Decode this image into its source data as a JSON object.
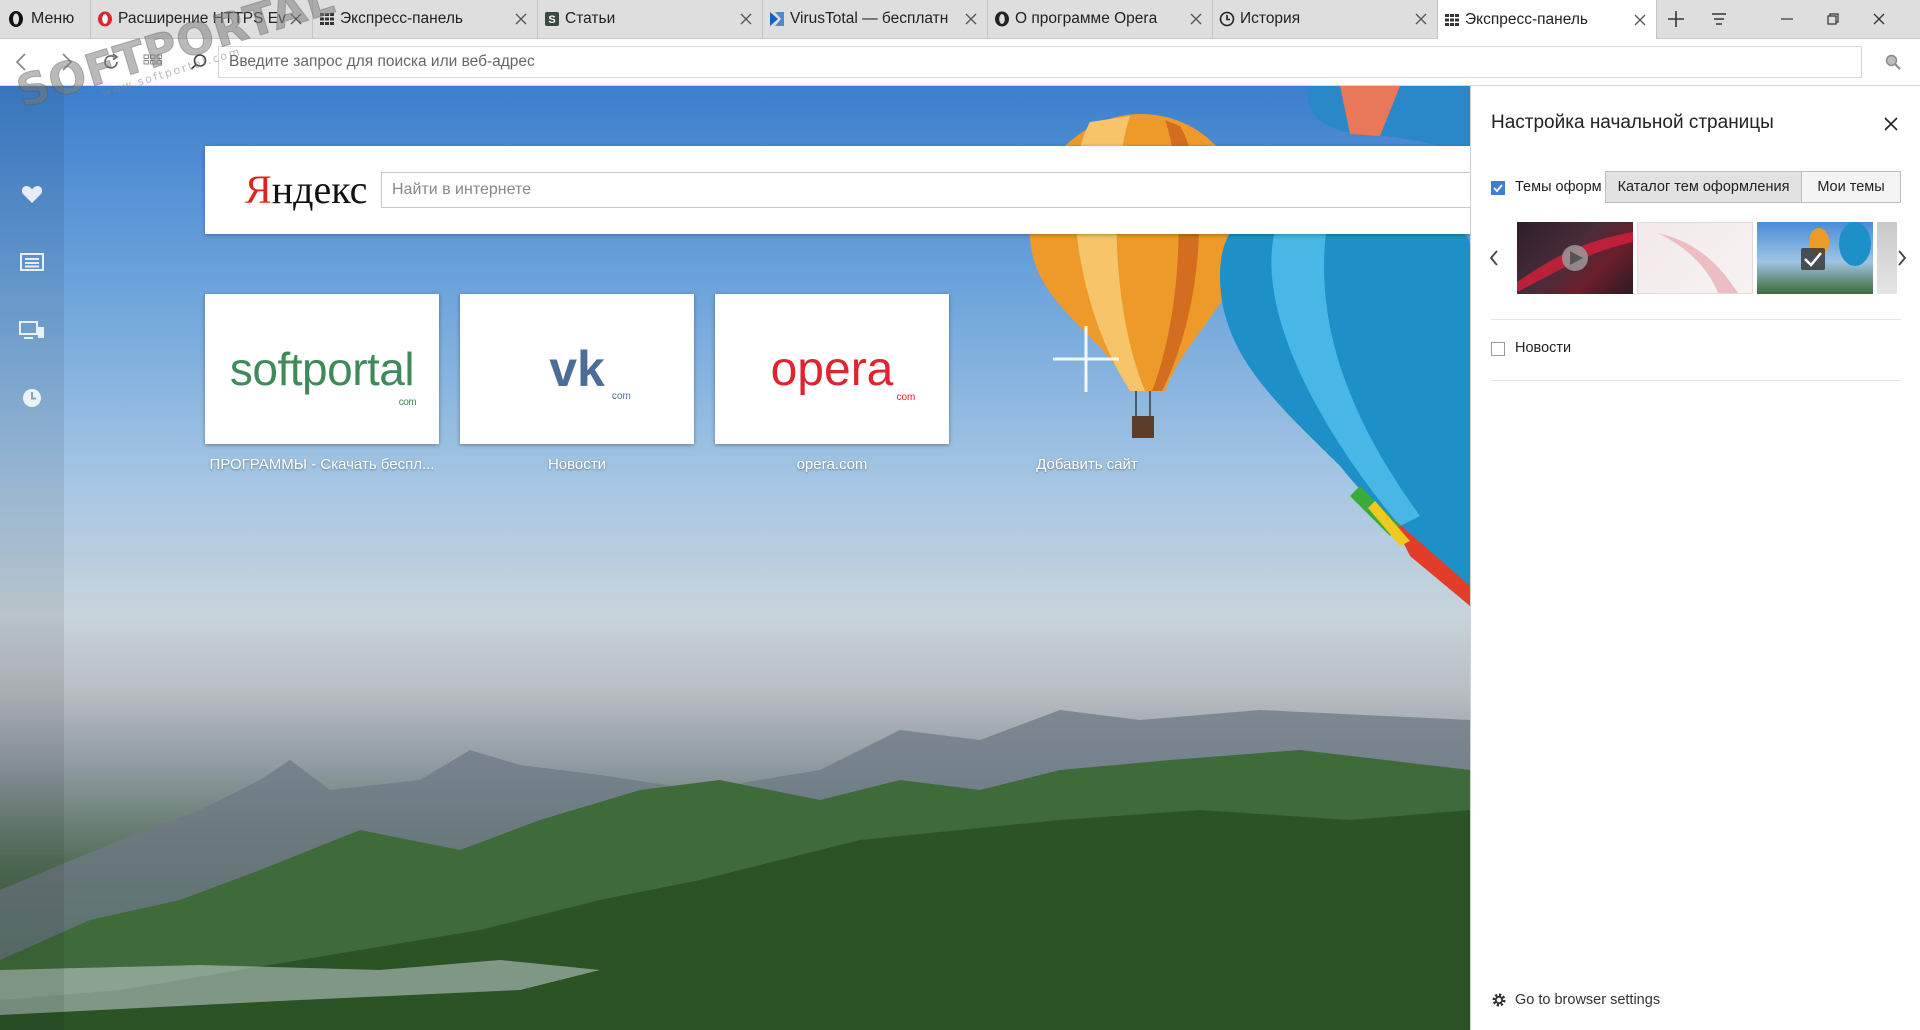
{
  "menu": {
    "label": "Меню"
  },
  "tabs": [
    {
      "title": "Расширение HTTPS Ev",
      "favicon": "opera-icon"
    },
    {
      "title": "Экспресс-панель",
      "favicon": "speed-dial-icon"
    },
    {
      "title": "Статьи",
      "favicon": "softportal-icon"
    },
    {
      "title": "VirusTotal — бесплатн",
      "favicon": "virustotal-icon"
    },
    {
      "title": "О программе Opera",
      "favicon": "opera-icon"
    },
    {
      "title": "История",
      "favicon": "history-icon"
    },
    {
      "title": "Экспресс-панель",
      "favicon": "speed-dial-icon",
      "active": true
    }
  ],
  "address": {
    "placeholder": "Введите запрос для поиска или веб-адрес"
  },
  "watermark": {
    "brand": "SOFTPORTAL",
    "url": "www.softportal.com"
  },
  "yandex": {
    "logo_first": "Я",
    "logo_rest": "ндекс",
    "placeholder": "Найти в интернете"
  },
  "speed_dial": [
    {
      "label": "ПРОГРАММЫ - Скачать беспл...",
      "logo": "softportal",
      "suffix": "com"
    },
    {
      "label": "Новости",
      "logo": "vk",
      "suffix": "com"
    },
    {
      "label": "opera.com",
      "logo": "opera",
      "suffix": "com"
    }
  ],
  "add_site": {
    "label": "Добавить сайт"
  },
  "panel": {
    "title": "Настройка начальной страницы",
    "themes_label": "Темы оформ",
    "themes_checked": true,
    "catalog_label": "Каталог тем оформления",
    "my_themes_label": "Мои темы",
    "news_label": "Новости",
    "news_checked": false,
    "settings_link": "Go to browser settings"
  },
  "colors": {
    "accent": "#3b7fd6",
    "yandex_red": "#e4211f",
    "softportal_green": "#3e8a5a",
    "vk_blue": "#4c6d97",
    "opera_red": "#e0242f"
  }
}
